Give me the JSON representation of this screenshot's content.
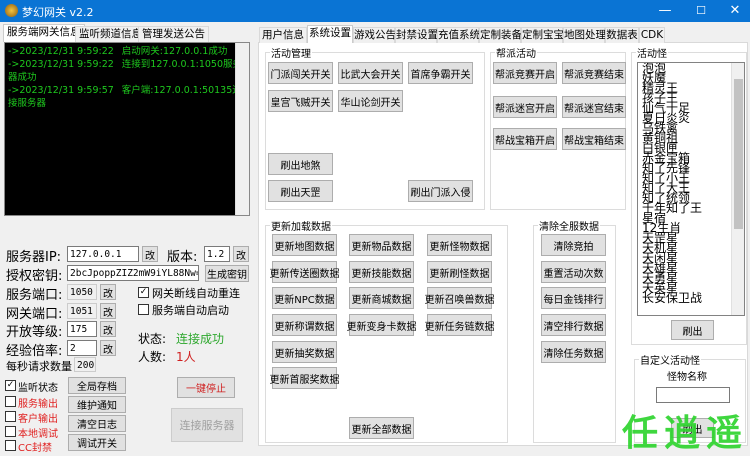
{
  "window": {
    "title": "梦幻网关 v2.2",
    "minimize": "—",
    "maximize": "☐",
    "close": "✕"
  },
  "left_tabs": [
    "服务端网关信息",
    "监听频道信息",
    "管理发送公告"
  ],
  "log": [
    {
      "time": "->2023/12/31 9:59:22",
      "msg": "启动网关:127.0.0.1成功"
    },
    {
      "time": "->2023/12/31 9:59:22",
      "msg": "连接到127.0.0.1:1050服务器成功"
    },
    {
      "time": "->2023/12/31 9:59:57",
      "msg": "客户端:127.0.0.1:50135连接服务器"
    }
  ],
  "form": {
    "server_ip_label": "服务器IP:",
    "server_ip": "127.0.0.1",
    "version_label": "版本:",
    "version": "1.2",
    "key_label": "授权密钥:",
    "key": "2bcJpoppZIZ2mW9iYL88Nw==",
    "gen_key": "生成密钥",
    "server_port_label": "服务端口:",
    "server_port": "1050",
    "gateway_port_label": "网关端口:",
    "gateway_port": "1051",
    "open_level_label": "开放等级:",
    "open_level": "175",
    "exp_rate_label": "经验倍率:",
    "exp_rate": "2",
    "req_per_sec_label": "每秒请求数量",
    "req_per_sec": "200",
    "change": "改",
    "auto_reconnect": "网关断线自动重连",
    "auto_reconnect_checked": true,
    "auto_start": "服务端自动启动",
    "auto_start_checked": false,
    "status_label": "状态:",
    "status": "连接成功",
    "status_color": "#2ea82e",
    "count_label": "人数:",
    "count": "1人",
    "count_color": "#d02020"
  },
  "checks": [
    {
      "label": "监听状态",
      "checked": true,
      "color": "#000"
    },
    {
      "label": "服务输出",
      "checked": false,
      "color": "#e02020"
    },
    {
      "label": "客户输出",
      "checked": false,
      "color": "#e02020"
    },
    {
      "label": "本地调试",
      "checked": false,
      "color": "#e02020"
    },
    {
      "label": "CC封禁",
      "checked": false,
      "color": "#e02020"
    }
  ],
  "left_buttons": [
    "全局存档",
    "维护通知",
    "清空日志",
    "调试开关"
  ],
  "stop_all": "一键停止",
  "connect": "连接服务器",
  "right_tabs": [
    "用户信息",
    "系统设置",
    "游戏公告",
    "封禁设置",
    "充值系统",
    "定制装备",
    "定制宝宝",
    "地图处理",
    "数据表",
    "CDK"
  ],
  "activity": {
    "title": "活动管理",
    "buttons": [
      "门派闯关开关",
      "比武大会开关",
      "首席争霸开关",
      "皇宫飞贼开关",
      "华山论剑开关",
      "刷出地煞",
      "刷出天罡",
      "刷出门派入侵"
    ]
  },
  "guild": {
    "title": "帮派活动",
    "buttons": [
      "帮派竞赛开启",
      "帮派竞赛结束",
      "帮派迷宫开启",
      "帮派迷宫结束",
      "帮战宝箱开启",
      "帮战宝箱结束"
    ]
  },
  "monsters": {
    "title": "活动怪",
    "items": [
      "泡泡",
      "妖魔",
      "精灵王",
      "孩子王",
      "仙气十足",
      "夏日炎炎",
      "乌铁禽",
      "黄铜祖",
      "白银匣",
      "赤金宝箱",
      "知了先锋",
      "知了小王",
      "知了大王",
      "知了统领",
      "千年知了王",
      "星宿",
      "12生肖",
      "天罡星",
      "天机星",
      "天闲星",
      "天雄星",
      "天勇星",
      "天英星",
      "长安保卫战"
    ],
    "spawn": "刷出"
  },
  "update": {
    "title": "更新加载数据",
    "buttons": [
      "更新地图数据",
      "更新物品数据",
      "更新怪物数据",
      "更新传送圈数据",
      "更新技能数据",
      "更新刷怪数据",
      "更新NPC数据",
      "更新商城数据",
      "更新召唤兽数据",
      "更新称谓数据",
      "更新变身卡数据",
      "更新任务链数据",
      "更新抽奖数据",
      "更新首服奖数据",
      "更新全部数据"
    ]
  },
  "clear": {
    "title": "清除全服数据",
    "buttons": [
      "清除竞拍",
      "重置活动次数",
      "每日金钱排行",
      "清空排行数据",
      "清除任务数据"
    ]
  },
  "custom": {
    "title": "自定义活动怪",
    "name_label": "怪物名称",
    "name_value": "",
    "spawn": "刷出"
  },
  "watermark": "任逍遥"
}
